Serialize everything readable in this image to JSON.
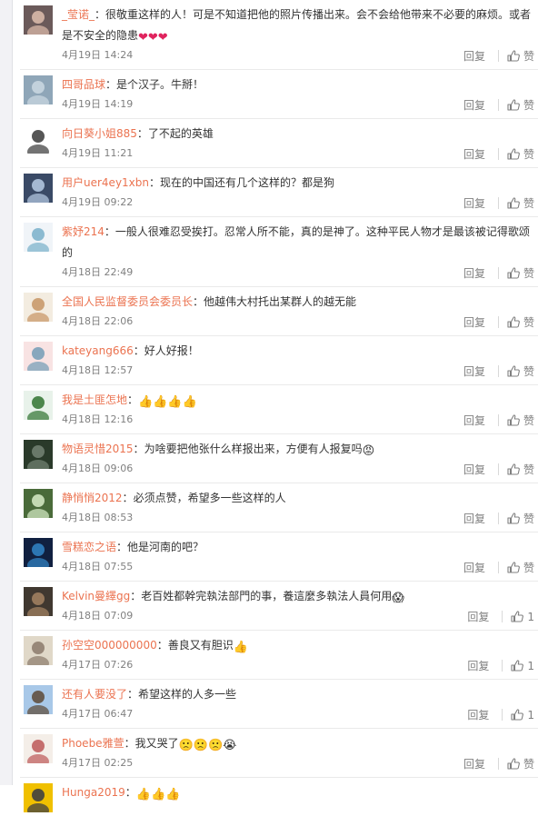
{
  "comments": [
    {
      "user": "_莹诺_",
      "sep": "：",
      "text": "很敬重这样的人！可是不知道把他的照片传播出来。会不会给他带来不必要的麻烦。或者是不安全的隐患",
      "emoji": "❤❤❤",
      "date": "4月19日 14:24",
      "reply": "回复",
      "like": "赞",
      "tall": true
    },
    {
      "user": "四哥品球",
      "sep": "：",
      "text": "是个汉子。牛掰！",
      "emoji": "",
      "date": "4月19日 14:19",
      "reply": "回复",
      "like": "赞"
    },
    {
      "user": "向日葵小姐885",
      "sep": "：",
      "text": "了不起的英雄",
      "emoji": "",
      "date": "4月19日 11:21",
      "reply": "回复",
      "like": "赞"
    },
    {
      "user": "用户uer4ey1xbn",
      "sep": "：",
      "text": "现在的中国还有几个这样的？都是狗",
      "emoji": "",
      "date": "4月19日 09:22",
      "reply": "回复",
      "like": "赞"
    },
    {
      "user": "紫妤214",
      "sep": "：",
      "text": "一般人很难忍受挨打。忍常人所不能，真的是神了。这种平民人物才是最该被记得歌颂的",
      "emoji": "",
      "date": "4月18日 22:49",
      "reply": "回复",
      "like": "赞",
      "tall": true
    },
    {
      "user": "全国人民监督委员会委员长",
      "sep": "：",
      "text": "他越伟大村托出某群人的越无能",
      "emoji": "",
      "date": "4月18日 22:06",
      "reply": "回复",
      "like": "赞"
    },
    {
      "user": "kateyang666",
      "sep": "：",
      "text": "好人好报！",
      "emoji": "",
      "date": "4月18日 12:57",
      "reply": "回复",
      "like": "赞"
    },
    {
      "user": "我是土匪怎地",
      "sep": "：",
      "text": "",
      "emoji": "👍👍👍👍",
      "date": "4月18日 12:16",
      "reply": "回复",
      "like": "赞"
    },
    {
      "user": "物语灵惜2015",
      "sep": "：",
      "text": "为啥要把他张什么样报出来，方便有人报复吗",
      "emoji": "😡",
      "date": "4月18日 09:06",
      "reply": "回复",
      "like": "赞"
    },
    {
      "user": "静悄悄2012",
      "sep": "：",
      "text": "必须点赞，希望多一些这样的人",
      "emoji": "",
      "date": "4月18日 08:53",
      "reply": "回复",
      "like": "赞"
    },
    {
      "user": "雪糕恋之语",
      "sep": "：",
      "text": "他是河南的吧？",
      "emoji": "",
      "date": "4月18日 07:55",
      "reply": "回复",
      "like": "赞"
    },
    {
      "user": "Kelvin曼繹gg",
      "sep": "：",
      "text": "老百姓都幹完執法部門的事，養這麼多執法人員何用",
      "emoji": "😱",
      "date": "4月18日 07:09",
      "reply": "回复",
      "like": "1"
    },
    {
      "user": "孙空空000000000",
      "sep": "：",
      "text": "善良又有胆识",
      "emoji": "👍",
      "date": "4月17日 07:26",
      "reply": "回复",
      "like": "1"
    },
    {
      "user": "还有人要没了",
      "sep": "：",
      "text": "希望这样的人多一些",
      "emoji": "",
      "date": "4月17日 06:47",
      "reply": "回复",
      "like": "1"
    },
    {
      "user": "Phoebe雅萱",
      "sep": "：",
      "text": "我又哭了",
      "emoji": "🙁🙁🙁😭",
      "date": "4月17日 02:25",
      "reply": "回复",
      "like": "赞"
    },
    {
      "user": "Hunga2019",
      "sep": "：",
      "text": "",
      "emoji": "👍👍👍",
      "date": "",
      "reply": "",
      "like": ""
    }
  ],
  "colors": {
    "username": "#eb7350",
    "text": "#333333",
    "meta": "#808080",
    "divider": "#eaeaea"
  }
}
